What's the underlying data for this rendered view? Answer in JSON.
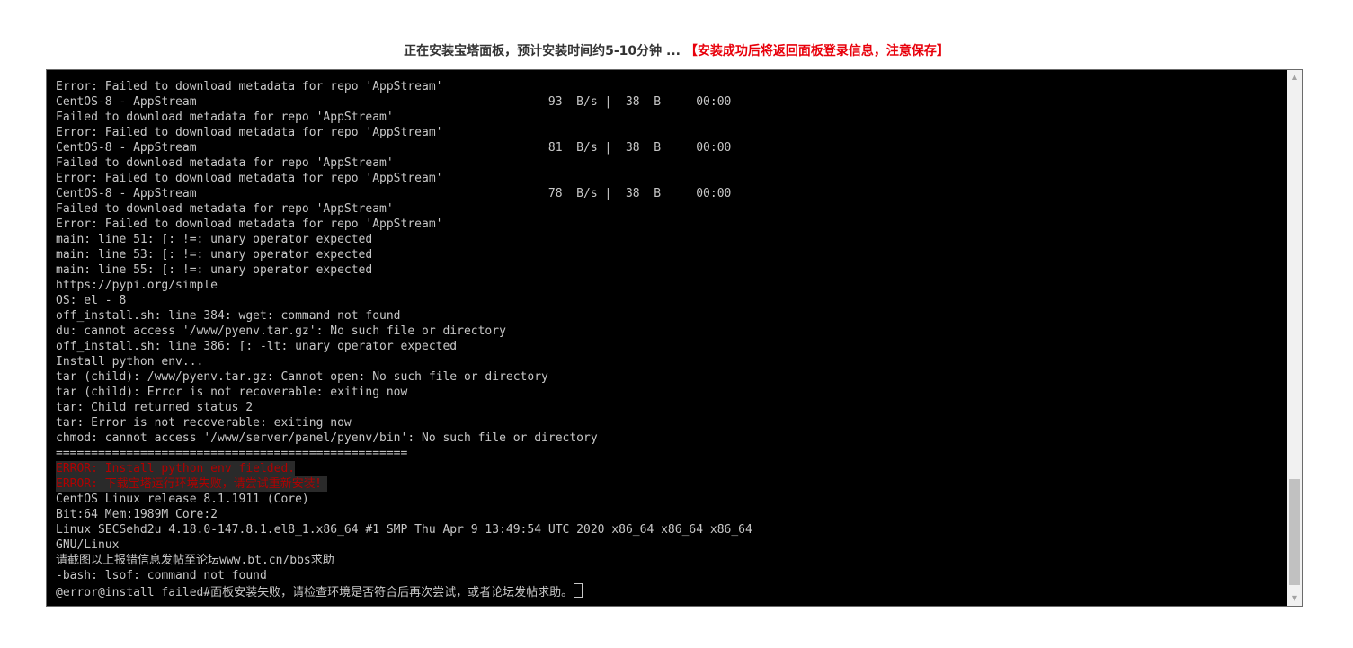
{
  "header": {
    "message": "正在安装宝塔面板，预计安装时间约5-10分钟 ...",
    "warning": "【安装成功后将返回面板登录信息，注意保存】"
  },
  "terminal": {
    "lines": [
      "Error: Failed to download metadata for repo 'AppStream'",
      "CentOS-8 - AppStream                                                  93  B/s |  38  B     00:00",
      "Failed to download metadata for repo 'AppStream'",
      "Error: Failed to download metadata for repo 'AppStream'",
      "CentOS-8 - AppStream                                                  81  B/s |  38  B     00:00",
      "Failed to download metadata for repo 'AppStream'",
      "Error: Failed to download metadata for repo 'AppStream'",
      "CentOS-8 - AppStream                                                  78  B/s |  38  B     00:00",
      "Failed to download metadata for repo 'AppStream'",
      "Error: Failed to download metadata for repo 'AppStream'",
      "main: line 51: [: !=: unary operator expected",
      "main: line 53: [: !=: unary operator expected",
      "main: line 55: [: !=: unary operator expected",
      "https://pypi.org/simple",
      "OS: el - 8",
      "off_install.sh: line 384: wget: command not found",
      "du: cannot access '/www/pyenv.tar.gz': No such file or directory",
      "off_install.sh: line 386: [: -lt: unary operator expected",
      "Install python env...",
      "tar (child): /www/pyenv.tar.gz: Cannot open: No such file or directory",
      "tar (child): Error is not recoverable: exiting now",
      "tar: Child returned status 2",
      "tar: Error is not recoverable: exiting now",
      "chmod: cannot access '/www/server/panel/pyenv/bin': No such file or directory",
      "=================================================="
    ],
    "error_lines": [
      "ERROR: Install python env fielded.",
      "ERROR: 下载宝塔运行环境失败，请尝试重新安装！"
    ],
    "tail_lines": [
      "CentOS Linux release 8.1.1911 (Core)",
      "Bit:64 Mem:1989M Core:2",
      "Linux SECSehd2u 4.18.0-147.8.1.el8_1.x86_64 #1 SMP Thu Apr 9 13:49:54 UTC 2020 x86_64 x86_64 x86_64",
      "GNU/Linux",
      "请截图以上报错信息发帖至论坛www.bt.cn/bbs求助",
      "-bash: lsof: command not found"
    ],
    "prompt_line": "@error@install failed#面板安装失败，请检查环境是否符合后再次尝试，或者论坛发帖求助。"
  },
  "scrollbar": {
    "up_icon": "▲",
    "down_icon": "▼"
  }
}
